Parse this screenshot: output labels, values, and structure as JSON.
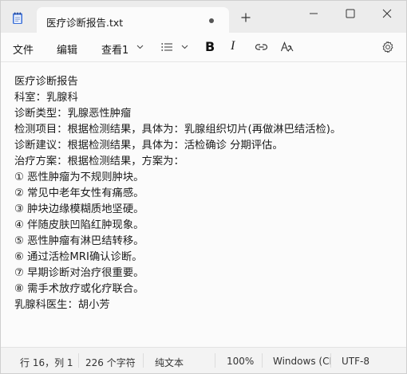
{
  "tab": {
    "title": "医疗诊断报告.txt"
  },
  "menu": {
    "file": "文件",
    "edit": "编辑",
    "view": "查看1"
  },
  "document": {
    "lines": [
      "医疗诊断报告",
      "科室：乳腺科",
      "诊断类型：乳腺恶性肿瘤",
      "检测项目：根据检测结果，具体为：乳腺组织切片(再做淋巴结活检)。",
      "诊断建议：根据检测结果，具体为：活检确诊 分期评估。",
      "治疗方案：根据检测结果，方案为：",
      "① 恶性肿瘤为不规则肿块。",
      "② 常见中老年女性有痛感。",
      "③ 肿块边缘模糊质地坚硬。",
      "④ 伴随皮肤凹陷红肿现象。",
      "⑤ 恶性肿瘤有淋巴结转移。",
      "⑥ 通过活检MRI确认诊断。",
      "⑦ 早期诊断对治疗很重要。",
      "⑧ 需手术放疗或化疗联合。",
      "乳腺科医生：胡小芳"
    ]
  },
  "status": {
    "position": "行 16，列 1",
    "chars": "226 个字符",
    "format": "纯文本",
    "zoom": "100%",
    "line_ending": "Windows (CI",
    "encoding": "UTF-8"
  },
  "icons": {
    "app": "notepad-icon",
    "new_tab": "plus-icon",
    "minimize": "minimize-icon",
    "maximize": "maximize-icon",
    "close": "close-icon",
    "list": "list-icon",
    "bold": "bold-icon",
    "italic": "italic-icon",
    "link": "link-icon",
    "clear_format": "clear-formatting-icon",
    "settings": "gear-icon"
  },
  "colors": {
    "accent": "#3a6fd8",
    "background": "#fbfbfb",
    "chrome": "#ececec"
  }
}
